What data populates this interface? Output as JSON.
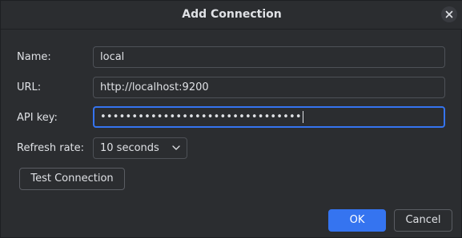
{
  "dialog": {
    "title": "Add Connection"
  },
  "form": {
    "name_label": "Name:",
    "name_value": "local",
    "url_label": "URL:",
    "url_value": "http://localhost:9200",
    "apikey_label": "API key:",
    "apikey_masked": "••••••••••••••••••••••••••••••••",
    "refresh_label": "Refresh rate:",
    "refresh_value": "10 seconds"
  },
  "buttons": {
    "test_connection": "Test Connection",
    "ok": "OK",
    "cancel": "Cancel"
  },
  "colors": {
    "accent": "#3574f0",
    "background": "#2b2d30"
  },
  "icons": {
    "close": "close-icon",
    "dropdown": "chevron-down-icon"
  }
}
